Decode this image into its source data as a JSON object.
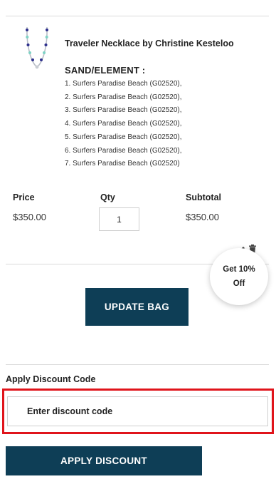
{
  "product": {
    "title": "Traveler Necklace by Christine Kesteloo",
    "option_label": "SAND/ELEMENT :",
    "options": [
      "1. Surfers Paradise Beach (G02520),",
      "2. Surfers Paradise Beach (G02520),",
      "3. Surfers Paradise Beach (G02520),",
      "4. Surfers Paradise Beach (G02520),",
      "5. Surfers Paradise Beach (G02520),",
      "6. Surfers Paradise Beach (G02520),",
      "7. Surfers Paradise Beach (G02520)"
    ]
  },
  "line_item": {
    "price_label": "Price",
    "price": "$350.00",
    "qty_label": "Qty",
    "qty": "1",
    "subtotal_label": "Subtotal",
    "subtotal": "$350.00"
  },
  "promo": {
    "line1": "Get 10%",
    "line2": "Off"
  },
  "update_bag_label": "UPDATE BAG",
  "discount": {
    "title": "Apply Discount Code",
    "placeholder": "Enter discount code",
    "button_label": "APPLY DISCOUNT"
  },
  "colors": {
    "button": "#0e3e56",
    "highlight": "#e0141b"
  },
  "icons": [
    "necklace-thumbnail",
    "edit-icon",
    "trash-icon"
  ]
}
